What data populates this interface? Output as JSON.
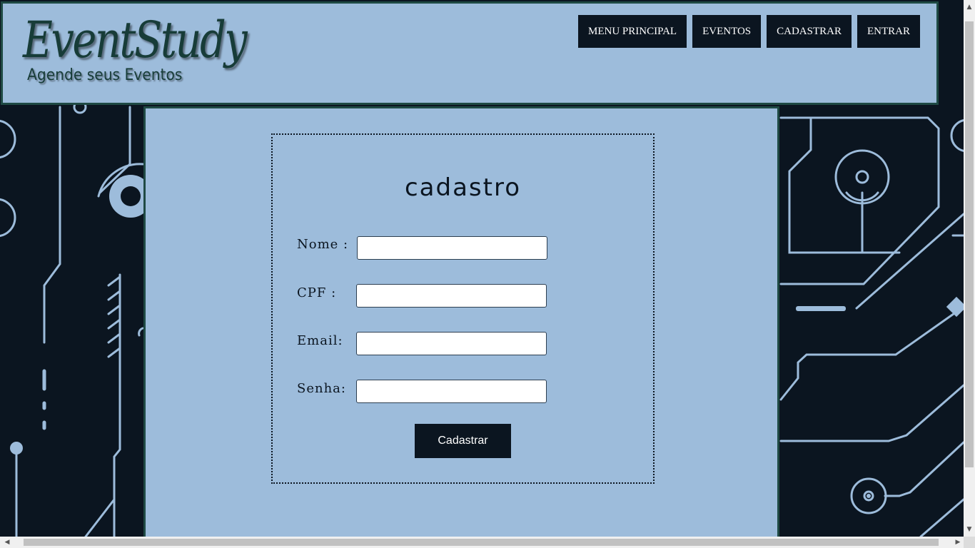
{
  "logo": {
    "title": "EventStudy",
    "subtitle": "Agende seus Eventos"
  },
  "nav": {
    "items": [
      {
        "label": "MENU PRINCIPAL"
      },
      {
        "label": "EVENTOS"
      },
      {
        "label": "CADASTRAR"
      },
      {
        "label": "ENTRAR"
      }
    ]
  },
  "form": {
    "title": "Cadastro",
    "fields": [
      {
        "label": "Nome :",
        "value": ""
      },
      {
        "label": "CPF :",
        "value": ""
      },
      {
        "label": "Email:",
        "value": ""
      },
      {
        "label": "Senha:",
        "value": ""
      }
    ],
    "submit_label": "Cadastrar"
  },
  "colors": {
    "panel": "#9dbcdb",
    "dark": "#0b1520",
    "border": "#1f4a44",
    "circuit": "#9dbcdb"
  },
  "icons": {
    "scroll_up": "triangle-up-icon",
    "scroll_down": "triangle-down-icon",
    "scroll_left": "triangle-left-icon",
    "scroll_right": "triangle-right-icon"
  }
}
